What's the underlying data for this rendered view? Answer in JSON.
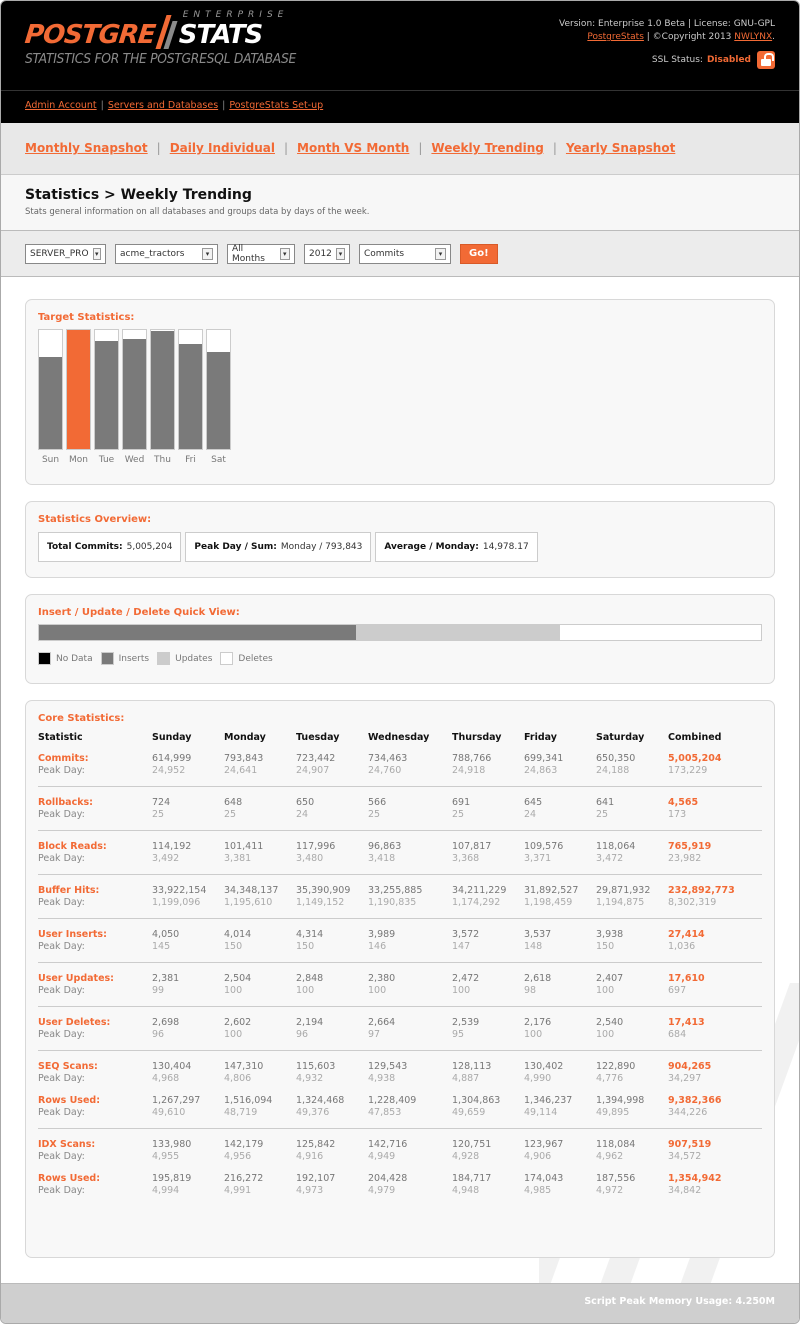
{
  "header": {
    "logo_part1": "POSTGRE",
    "logo_part2": "STATS",
    "logo_edition": "ENTERPRISE",
    "tagline": "STATISTICS FOR THE POSTGRESQL DATABASE",
    "version_line": "Version: Enterprise 1.0 Beta | License: GNU-GPL",
    "product_link": "PostgreStats",
    "copyright_text": " | ©Copyright 2013 ",
    "company_link": "NWLYNX",
    "ssl_label": "SSL Status:",
    "ssl_status": "Disabled",
    "ssl_icon": "unlocked-padlock-icon"
  },
  "subnav": {
    "items": [
      "Admin Account",
      "Servers and Databases",
      "PostgreStats Set-up"
    ],
    "separator": "|"
  },
  "mainnav": {
    "items": [
      "Monthly Snapshot",
      "Daily Individual",
      "Month VS Month",
      "Weekly Trending",
      "Yearly Snapshot"
    ],
    "separator": "|"
  },
  "page": {
    "title": "Statistics > Weekly Trending",
    "subtitle": "Stats general information on all databases and groups data by days of the week."
  },
  "filters": {
    "server": "SERVER_PRO",
    "database": "acme_tractors",
    "month": "All Months",
    "year": "2012",
    "metric": "Commits",
    "go_label": "Go!"
  },
  "colors": {
    "accent": "#f26a35",
    "bar_gray": "#7a7a7a",
    "updates_gray": "#cccccc"
  },
  "target_stats": {
    "title": "Target Statistics:",
    "peak_day": "Mon"
  },
  "chart_data": {
    "type": "bar",
    "title": "Target Statistics:",
    "categories": [
      "Sun",
      "Mon",
      "Tue",
      "Wed",
      "Thu",
      "Fri",
      "Sat"
    ],
    "values": [
      614999,
      793843,
      723442,
      734463,
      788766,
      699341,
      650350
    ],
    "ylim": [
      0,
      793843
    ],
    "highlight": "Mon",
    "xlabel": "",
    "ylabel": ""
  },
  "overview": {
    "title": "Statistics Overview:",
    "items": [
      {
        "label": "Total Commits:",
        "value": "5,005,204"
      },
      {
        "label": "Peak Day / Sum:",
        "value": "Monday / 793,843"
      },
      {
        "label": "Average / Monday:",
        "value": "14,978.17"
      }
    ]
  },
  "quick_view": {
    "title": "Insert / Update / Delete Quick View:",
    "segments": [
      {
        "name": "Inserts",
        "value": 27414,
        "color": "#7a7a7a"
      },
      {
        "name": "Updates",
        "value": 17610,
        "color": "#cccccc"
      },
      {
        "name": "Deletes",
        "value": 17413,
        "color": "#ffffff"
      }
    ],
    "legend": [
      {
        "label": "No Data",
        "color": "#000000"
      },
      {
        "label": "Inserts",
        "color": "#7a7a7a"
      },
      {
        "label": "Updates",
        "color": "#cccccc"
      },
      {
        "label": "Deletes",
        "color": "#ffffff"
      }
    ]
  },
  "core": {
    "title": "Core Statistics:",
    "columns": [
      "Statistic",
      "Sunday",
      "Monday",
      "Tuesday",
      "Wednesday",
      "Thursday",
      "Friday",
      "Saturday",
      "Combined"
    ],
    "peak_label": "Peak Day:",
    "groups": [
      [
        {
          "name": "Commits:",
          "values": [
            "614,999",
            "793,843",
            "723,442",
            "734,463",
            "788,766",
            "699,341",
            "650,350",
            "5,005,204"
          ],
          "peaks": [
            "24,952",
            "24,641",
            "24,907",
            "24,760",
            "24,918",
            "24,863",
            "24,188",
            "173,229"
          ]
        }
      ],
      [
        {
          "name": "Rollbacks:",
          "values": [
            "724",
            "648",
            "650",
            "566",
            "691",
            "645",
            "641",
            "4,565"
          ],
          "peaks": [
            "25",
            "25",
            "24",
            "25",
            "25",
            "24",
            "25",
            "173"
          ]
        }
      ],
      [
        {
          "name": "Block Reads:",
          "values": [
            "114,192",
            "101,411",
            "117,996",
            "96,863",
            "107,817",
            "109,576",
            "118,064",
            "765,919"
          ],
          "peaks": [
            "3,492",
            "3,381",
            "3,480",
            "3,418",
            "3,368",
            "3,371",
            "3,472",
            "23,982"
          ]
        }
      ],
      [
        {
          "name": "Buffer Hits:",
          "values": [
            "33,922,154",
            "34,348,137",
            "35,390,909",
            "33,255,885",
            "34,211,229",
            "31,892,527",
            "29,871,932",
            "232,892,773"
          ],
          "peaks": [
            "1,199,096",
            "1,195,610",
            "1,149,152",
            "1,190,835",
            "1,174,292",
            "1,198,459",
            "1,194,875",
            "8,302,319"
          ]
        }
      ],
      [
        {
          "name": "User Inserts:",
          "values": [
            "4,050",
            "4,014",
            "4,314",
            "3,989",
            "3,572",
            "3,537",
            "3,938",
            "27,414"
          ],
          "peaks": [
            "145",
            "150",
            "150",
            "146",
            "147",
            "148",
            "150",
            "1,036"
          ]
        }
      ],
      [
        {
          "name": "User Updates:",
          "values": [
            "2,381",
            "2,504",
            "2,848",
            "2,380",
            "2,472",
            "2,618",
            "2,407",
            "17,610"
          ],
          "peaks": [
            "99",
            "100",
            "100",
            "100",
            "100",
            "98",
            "100",
            "697"
          ]
        }
      ],
      [
        {
          "name": "User Deletes:",
          "values": [
            "2,698",
            "2,602",
            "2,194",
            "2,664",
            "2,539",
            "2,176",
            "2,540",
            "17,413"
          ],
          "peaks": [
            "96",
            "100",
            "96",
            "97",
            "95",
            "100",
            "100",
            "684"
          ]
        }
      ],
      [
        {
          "name": "SEQ Scans:",
          "values": [
            "130,404",
            "147,310",
            "115,603",
            "129,543",
            "128,113",
            "130,402",
            "122,890",
            "904,265"
          ],
          "peaks": [
            "4,968",
            "4,806",
            "4,932",
            "4,938",
            "4,887",
            "4,990",
            "4,776",
            "34,297"
          ]
        },
        {
          "name": "Rows Used:",
          "values": [
            "1,267,297",
            "1,516,094",
            "1,324,468",
            "1,228,409",
            "1,304,863",
            "1,346,237",
            "1,394,998",
            "9,382,366"
          ],
          "peaks": [
            "49,610",
            "48,719",
            "49,376",
            "47,853",
            "49,659",
            "49,114",
            "49,895",
            "344,226"
          ]
        }
      ],
      [
        {
          "name": "IDX Scans:",
          "values": [
            "133,980",
            "142,179",
            "125,842",
            "142,716",
            "120,751",
            "123,967",
            "118,084",
            "907,519"
          ],
          "peaks": [
            "4,955",
            "4,956",
            "4,916",
            "4,949",
            "4,928",
            "4,906",
            "4,962",
            "34,572"
          ]
        },
        {
          "name": "Rows Used:",
          "values": [
            "195,819",
            "216,272",
            "192,107",
            "204,428",
            "184,717",
            "174,043",
            "187,556",
            "1,354,942"
          ],
          "peaks": [
            "4,994",
            "4,991",
            "4,973",
            "4,979",
            "4,948",
            "4,985",
            "4,972",
            "34,842"
          ]
        }
      ]
    ]
  },
  "footer": {
    "memory": "Script Peak Memory Usage: 4.250M"
  }
}
